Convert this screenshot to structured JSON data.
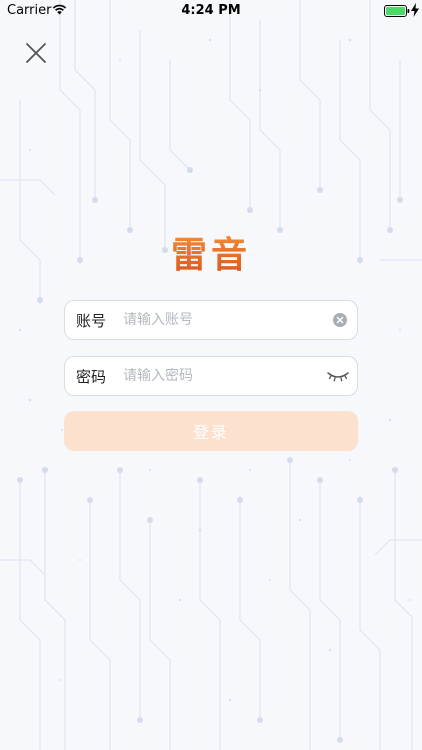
{
  "status_bar": {
    "carrier": "Carrier",
    "time": "4:24 PM",
    "wifi_icon": "wifi-icon",
    "battery_icon": "battery-icon",
    "battery_color": "#4cd964"
  },
  "close_icon": "close-icon",
  "logo_text": "雷音",
  "colors": {
    "logo_gradient": [
      "#f7963a",
      "#d9531c"
    ],
    "login_button_bg": "#fde1cf",
    "circuit_lines": "#dde3f0"
  },
  "form": {
    "account": {
      "label": "账号",
      "placeholder": "请输入账号",
      "value": ""
    },
    "password": {
      "label": "密码",
      "placeholder": "请输入密码",
      "value": ""
    },
    "login_label": "登录"
  }
}
